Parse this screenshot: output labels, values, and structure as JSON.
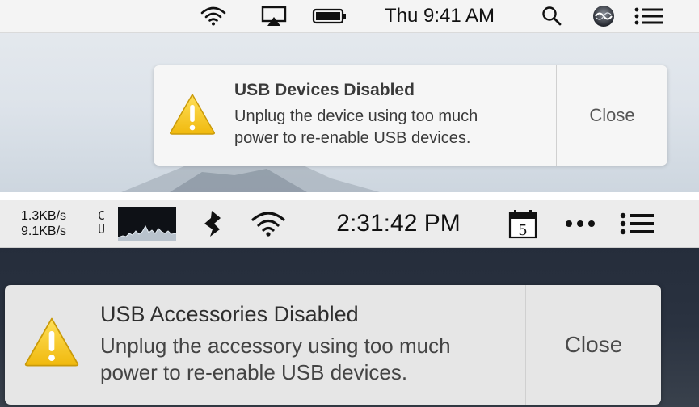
{
  "top": {
    "menubar": {
      "clock": "Thu 9:41 AM",
      "icons": [
        "wifi-icon",
        "airplay-icon",
        "battery-icon",
        "search-icon",
        "siri-icon",
        "notification-center-icon"
      ]
    },
    "notification": {
      "title": "USB Devices Disabled",
      "line1": "Unplug the device using too much",
      "line2": "power to re-enable USB devices.",
      "close": "Close",
      "icon": "warning-icon"
    }
  },
  "bottom": {
    "menubar": {
      "rate_up": "1.3KB/s",
      "rate_down": "9.1KB/s",
      "cpu_top": "C",
      "cpu_bottom": "U",
      "clock": "2:31:42 PM",
      "calendar_day": "5",
      "icons": [
        "cpu-graph-icon",
        "app-logo-icon",
        "wifi-icon",
        "calendar-icon",
        "more-icon",
        "notification-center-icon"
      ]
    },
    "notification": {
      "title": "USB Accessories Disabled",
      "line1": "Unplug the accessory using too much",
      "line2": "power to re-enable USB devices.",
      "close": "Close",
      "icon": "warning-icon"
    }
  },
  "colors": {
    "warning_fill": "#f2c21a",
    "warning_stroke": "#c99a0a",
    "dark_wallpaper": "#262e3b",
    "light_wallpaper": "#dde3ea"
  }
}
